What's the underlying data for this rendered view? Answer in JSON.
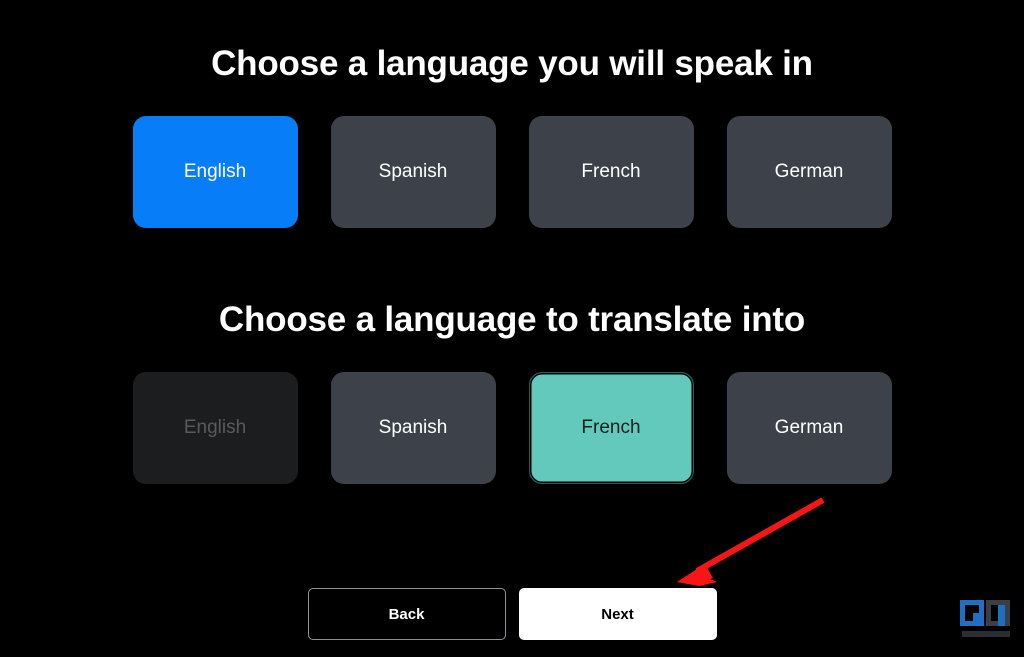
{
  "app": {
    "background_color": "#000000"
  },
  "source_section": {
    "heading": "Choose a language you will speak in",
    "options": [
      {
        "label": "English",
        "state": "selected",
        "color": "#077ef7"
      },
      {
        "label": "Spanish",
        "state": "default",
        "color": "#3c414a"
      },
      {
        "label": "French",
        "state": "default",
        "color": "#3c414a"
      },
      {
        "label": "German",
        "state": "default",
        "color": "#3c414a"
      }
    ]
  },
  "target_section": {
    "heading": "Choose a language to translate into",
    "options": [
      {
        "label": "English",
        "state": "disabled",
        "color": "#1c1d1f"
      },
      {
        "label": "Spanish",
        "state": "default",
        "color": "#3c414a"
      },
      {
        "label": "French",
        "state": "selected",
        "color": "#63c9bd"
      },
      {
        "label": "German",
        "state": "default",
        "color": "#3c414a"
      }
    ]
  },
  "navigation": {
    "back_label": "Back",
    "next_label": "Next"
  },
  "annotation": {
    "arrow_color": "#f81515",
    "points_to": "next-button"
  },
  "watermark": {
    "logo_text": "GU",
    "primary_color": "#1f6fc4",
    "secondary_color": "#3a3f46"
  }
}
